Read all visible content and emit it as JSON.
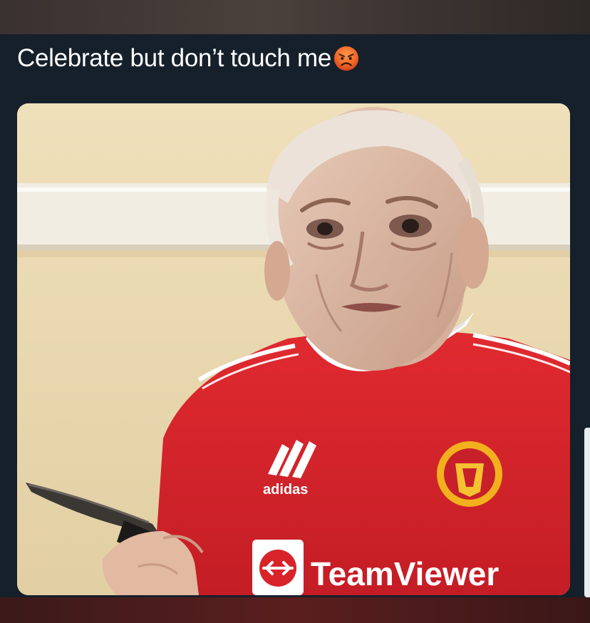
{
  "post": {
    "caption": "Celebrate but don’t touch me",
    "emoji": "angry-face-emoji"
  },
  "photo": {
    "jersey_brand": "adidas",
    "jersey_sponsor": "TeamViewer",
    "colors": {
      "wall": "#e8d7b0",
      "molding": "#f2efe7",
      "jersey_red": "#d9232b",
      "background_dark": "#15202b"
    }
  }
}
